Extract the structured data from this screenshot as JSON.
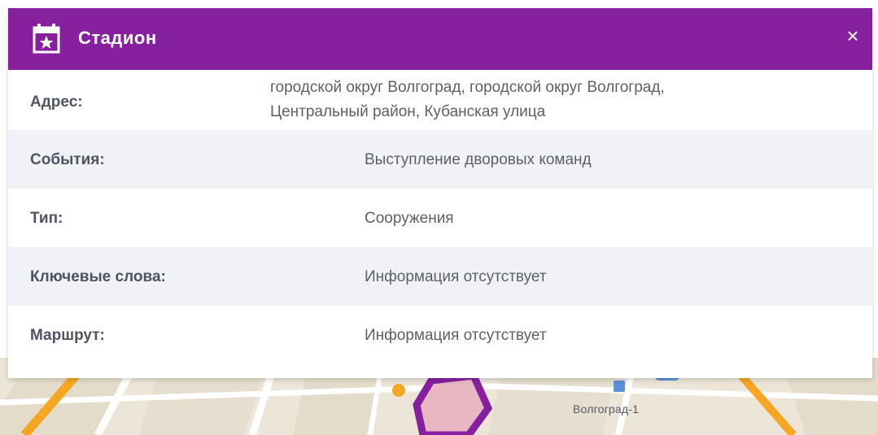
{
  "popup": {
    "title": "Стадион",
    "header_icon": "calendar-star-icon",
    "close_icon": "close-icon",
    "close_glyph": "×",
    "accent_color": "#86209f",
    "rows": [
      {
        "label": "Адрес:",
        "value_line1": "городской округ Волгоград, городской округ Волгоград,",
        "value_line2": "Центральный район, Кубанская улица"
      },
      {
        "label": "События:",
        "value": "Выступление дворовых команд"
      },
      {
        "label": "Тип:",
        "value": "Сооружения"
      },
      {
        "label": "Ключевые слова:",
        "value": "Информация отсутствует"
      },
      {
        "label": "Маршрут:",
        "value": "Информация отсутствует"
      }
    ]
  },
  "map": {
    "station_label": "Волгоград-1"
  }
}
